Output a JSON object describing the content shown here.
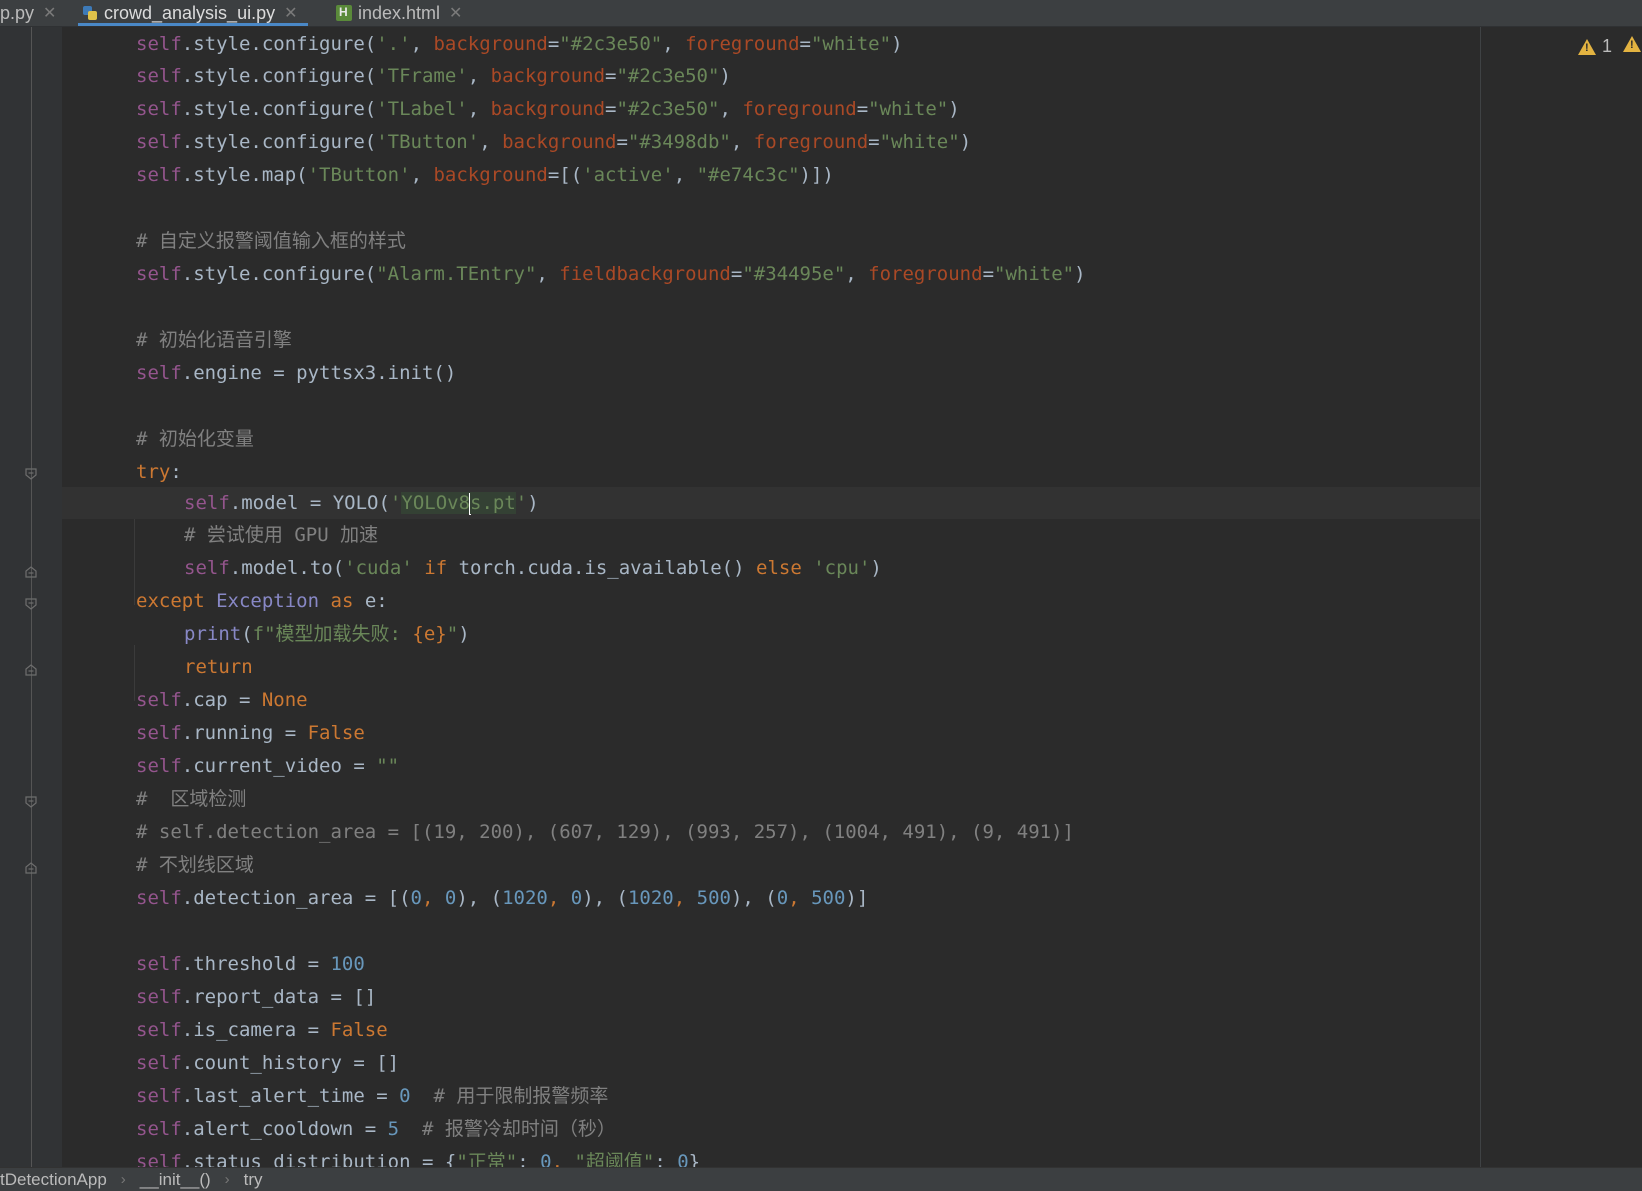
{
  "tabs": [
    {
      "label": "p.py",
      "icon": "file-icon"
    },
    {
      "label": "crowd_analysis_ui.py",
      "icon": "python-file-icon",
      "active": true
    },
    {
      "label": "index.html",
      "icon": "html-file-icon"
    }
  ],
  "tab_close_glyph": "✕",
  "warnings": {
    "count": "1"
  },
  "code": {
    "l1": {
      "a": "self",
      "b": ".style.configure(",
      "c": "'.'",
      "d": ", ",
      "e": "background",
      "f": "=",
      "g": "\"#2c3e50\"",
      "h": ", ",
      "i": "foreground",
      "j": "=",
      "k": "\"white\"",
      "l": ")"
    },
    "l2": {
      "a": "self",
      "b": ".style.configure(",
      "c": "'TFrame'",
      "d": ", ",
      "e": "background",
      "f": "=",
      "g": "\"#2c3e50\"",
      "h": ")"
    },
    "l3": {
      "a": "self",
      "b": ".style.configure(",
      "c": "'TLabel'",
      "d": ", ",
      "e": "background",
      "f": "=",
      "g": "\"#2c3e50\"",
      "h": ", ",
      "i": "foreground",
      "j": "=",
      "k": "\"white\"",
      "l": ")"
    },
    "l4": {
      "a": "self",
      "b": ".style.configure(",
      "c": "'TButton'",
      "d": ", ",
      "e": "background",
      "f": "=",
      "g": "\"#3498db\"",
      "h": ", ",
      "i": "foreground",
      "j": "=",
      "k": "\"white\"",
      "l": ")"
    },
    "l5": {
      "a": "self",
      "b": ".style.map(",
      "c": "'TButton'",
      "d": ", ",
      "e": "background",
      "f": "=[(",
      "g": "'active'",
      "h": ", ",
      "i": "\"#e74c3c\"",
      "j": ")])"
    },
    "c1": "# 自定义报警阈值输入框的样式",
    "l6": {
      "a": "self",
      "b": ".style.configure(",
      "c": "\"Alarm.TEntry\"",
      "d": ", ",
      "e": "fieldbackground",
      "f": "=",
      "g": "\"#34495e\"",
      "h": ", ",
      "i": "foreground",
      "j": "=",
      "k": "\"white\"",
      "l": ")"
    },
    "c2": "# 初始化语音引擎",
    "l7": {
      "a": "self",
      "b": ".engine = pyttsx3.init()"
    },
    "c3": "# 初始化变量",
    "l8": {
      "a": "try",
      "b": ":"
    },
    "l9": {
      "a": "self",
      "b": ".model = YOLO(",
      "c": "'",
      "d": "YOLOv8",
      "e": "s.pt",
      "f": "'",
      "g": ")"
    },
    "c4": "# 尝试使用 GPU 加速",
    "l10": {
      "a": "self",
      "b": ".model.to(",
      "c": "'cuda'",
      "d": " ",
      "e": "if",
      "f": " torch.cuda.is_available() ",
      "g": "else",
      "h": " ",
      "i": "'cpu'",
      "j": ")"
    },
    "l11": {
      "a": "except",
      "b": " ",
      "c": "Exception",
      "d": " ",
      "e": "as",
      "f": " e:"
    },
    "l12": {
      "a": "print",
      "b": "(",
      "c": "f\"模型加载失败: ",
      "d": "{e}",
      "e": "\"",
      "f": ")"
    },
    "l13": {
      "a": "return"
    },
    "l14": {
      "a": "self",
      "b": ".cap = ",
      "c": "None"
    },
    "l15": {
      "a": "self",
      "b": ".running = ",
      "c": "False"
    },
    "l16": {
      "a": "self",
      "b": ".current_video = ",
      "c": "\"\""
    },
    "c5": "#  区域检测",
    "c6": "# self.detection_area = [(19, 200), (607, 129), (993, 257), (1004, 491), (9, 491)]",
    "c7": "# 不划线区域",
    "l17": {
      "a": "self",
      "b": ".detection_area = [(",
      "c": "0",
      "d": ", ",
      "e": "0",
      "f": "), (",
      "g": "1020",
      "h": ", ",
      "i": "0",
      "j": "), (",
      "k": "1020",
      "l": ", ",
      "m": "500",
      "n": "), (",
      "o": "0",
      "p": ", ",
      "q": "500",
      "r": ")]"
    },
    "l18": {
      "a": "self",
      "b": ".threshold = ",
      "c": "100"
    },
    "l19": {
      "a": "self",
      "b": ".report_data = []"
    },
    "l20": {
      "a": "self",
      "b": ".is_camera = ",
      "c": "False"
    },
    "l21": {
      "a": "self",
      "b": ".count_history = []"
    },
    "l22": {
      "a": "self",
      "b": ".last_alert_time = ",
      "c": "0",
      "d": "  ",
      "e": "# 用于限制报警频率"
    },
    "l23": {
      "a": "self",
      "b": ".alert_cooldown = ",
      "c": "5",
      "d": "  ",
      "e": "# 报警冷却时间（秒）"
    },
    "l24": {
      "a": "self",
      "b": ".status_distribution = {",
      "c": "\"正常\"",
      "d": ": ",
      "e": "0",
      "f": ", ",
      "g": "\"超阈值\"",
      "h": ": ",
      "i": "0",
      "j": "}"
    }
  },
  "breadcrumbs": [
    "tDetectionApp",
    "__init__()",
    "try"
  ],
  "breadcrumb_sep": "›"
}
